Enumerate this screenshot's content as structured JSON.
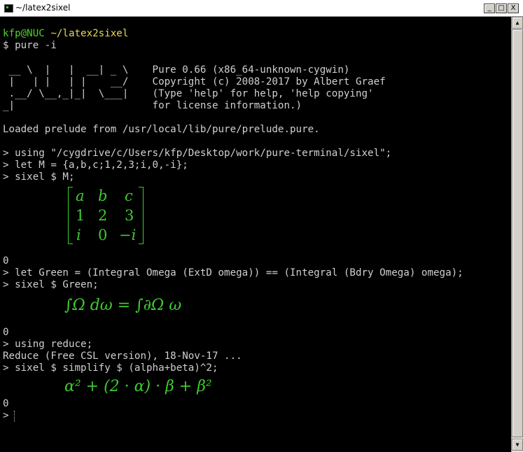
{
  "window": {
    "title": "~/latex2sixel",
    "minimize": "_",
    "maximize": "□",
    "close": "X"
  },
  "prompt": {
    "user_host": "kfp@NUC",
    "cwd": "~/latex2sixel"
  },
  "lines": {
    "cmd_pure": "$ pure -i",
    "banner1": " __ \\  |   |  __| _ \\    Pure 0.66 (x86_64-unknown-cygwin)",
    "banner2": " |   | |   | |    __/    Copyright (c) 2008-2017 by Albert Graef",
    "banner3": " .__/ \\__,_|_|  \\___|    (Type 'help' for help, 'help copying'",
    "banner4": "_|                       for license information.)",
    "loaded": "Loaded prelude from /usr/local/lib/pure/prelude.pure.",
    "using_sixel": "> using \"/cygdrive/c/Users/kfp/Desktop/work/pure-terminal/sixel\";",
    "let_m": "> let M = {a,b,c;1,2,3;i,0,-i};",
    "sixel_m": "> sixel $ M;",
    "zero1": "0",
    "let_green": "> let Green = (Integral Omega (ExtD omega)) == (Integral (Bdry Omega) omega);",
    "sixel_green": "> sixel $ Green;",
    "zero2": "0",
    "using_reduce": "> using reduce;",
    "reduce_banner": "Reduce (Free CSL version), 18-Nov-17 ...",
    "sixel_simplify": "> sixel $ simplify $ (alpha+beta)^2;",
    "zero3": "0",
    "prompt_final": ">"
  },
  "matrix": {
    "r1": [
      "a",
      "b",
      "c"
    ],
    "r2": [
      "1",
      "2",
      "3"
    ],
    "r3": [
      "i",
      "0",
      "−i"
    ]
  },
  "math": {
    "green": "∫Ω dω = ∫∂Ω ω",
    "simplify": "α² + (2 · α) · β + β²"
  },
  "colors": {
    "prompt": "#4ecf2a",
    "cwd": "#e7d950",
    "math": "#3ecb2f",
    "bg": "#000000",
    "text": "#d0d0d0"
  }
}
